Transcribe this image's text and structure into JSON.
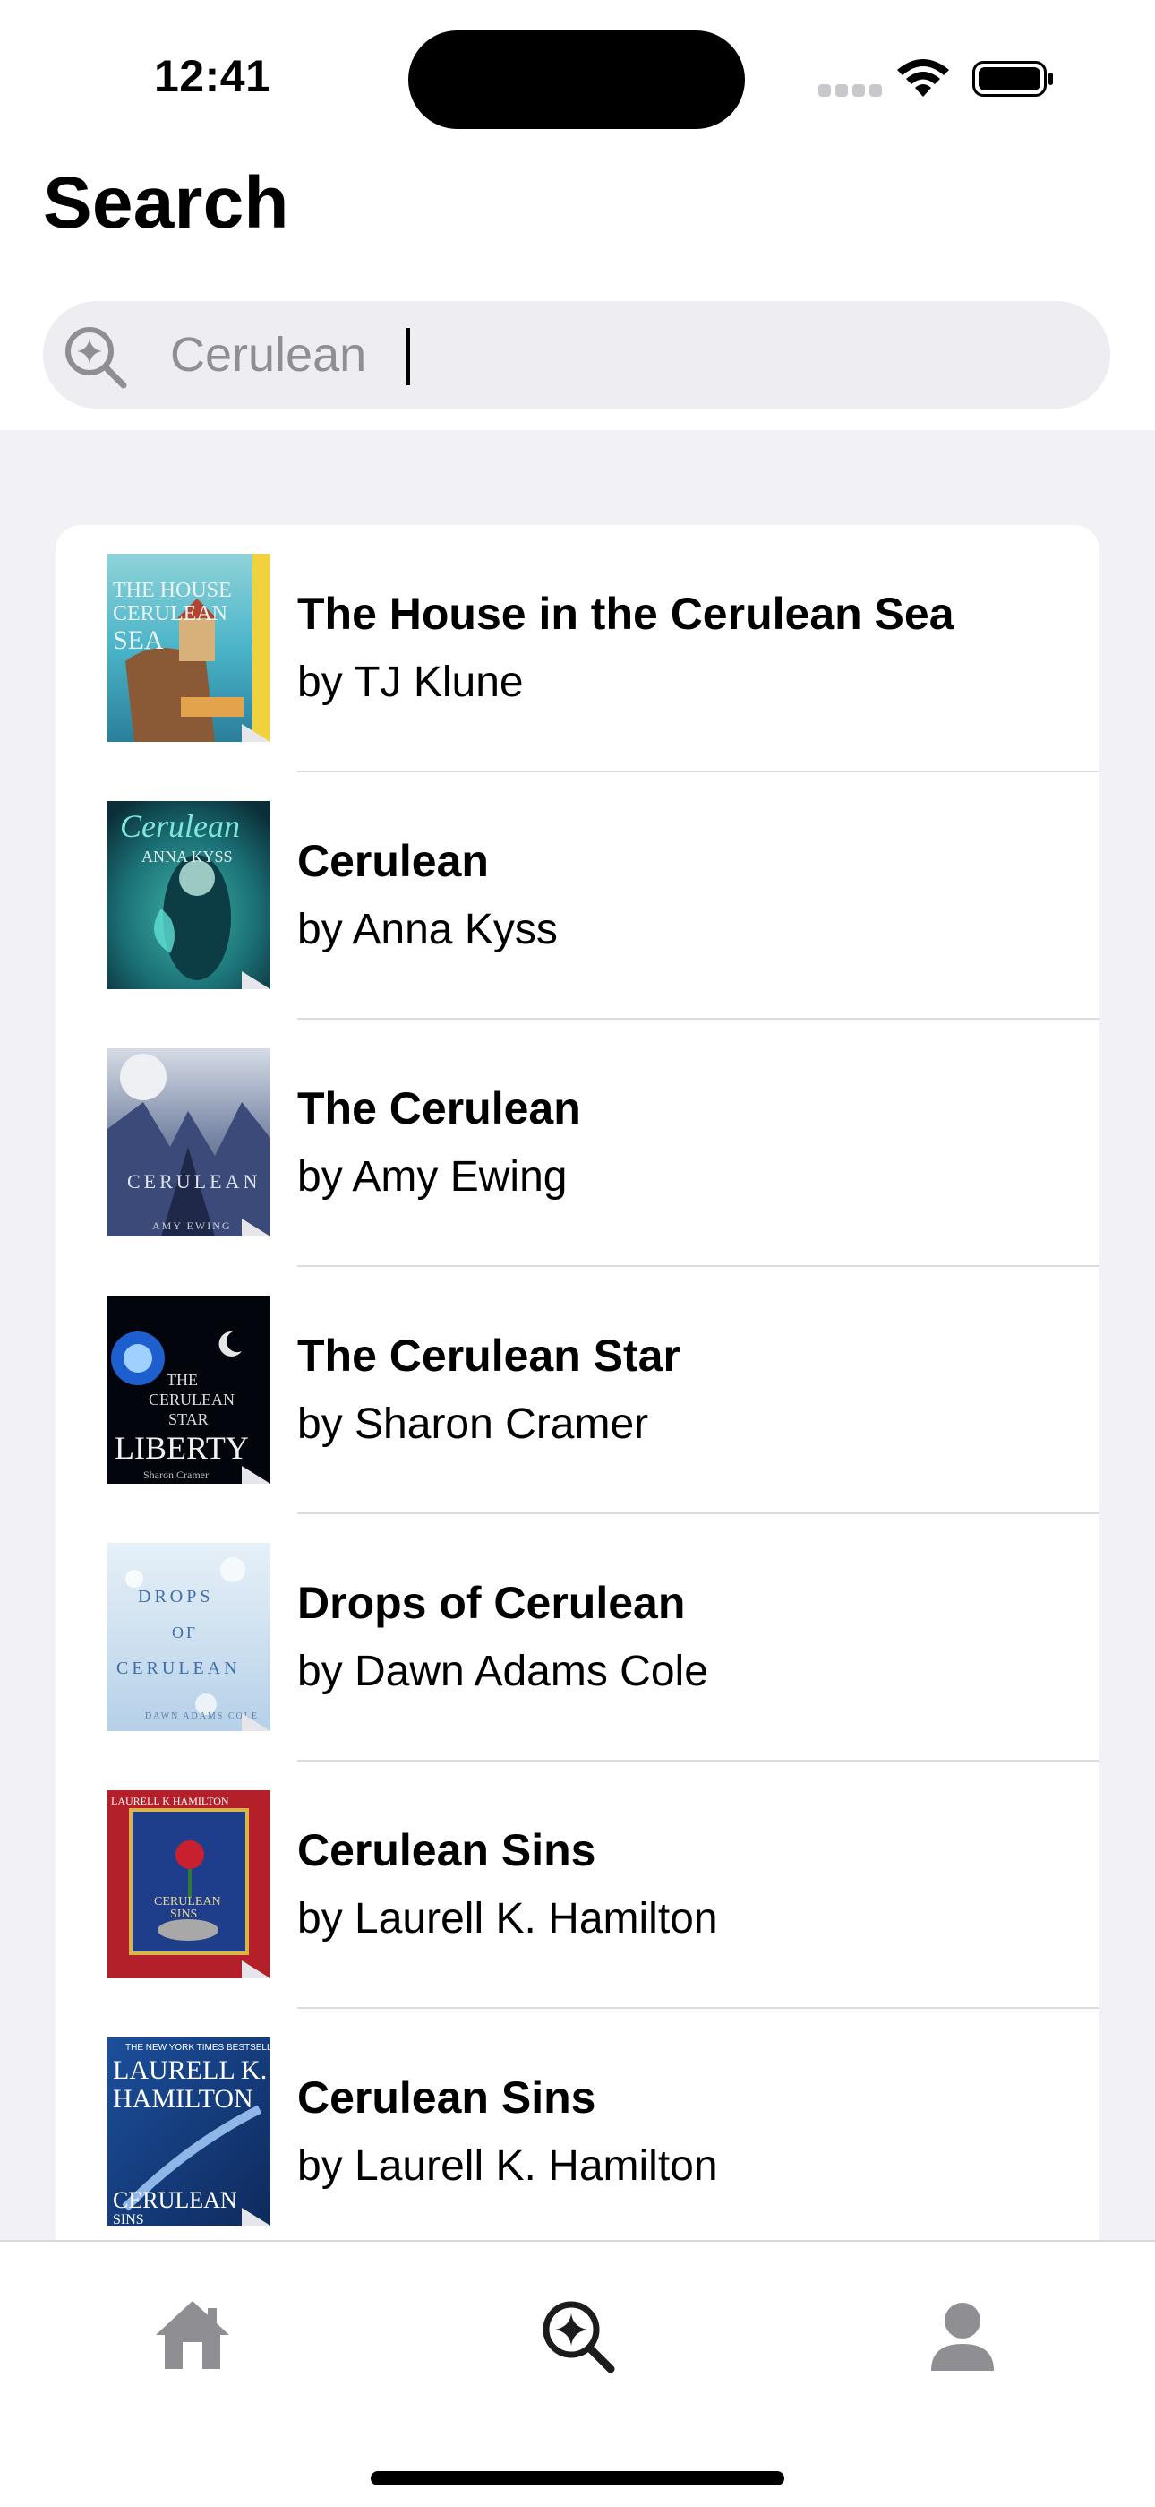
{
  "status_bar": {
    "time": "12:41"
  },
  "page": {
    "title": "Search"
  },
  "search": {
    "value": "Cerulean",
    "icon": "search-sparkle-icon"
  },
  "results": [
    {
      "title": "The House in the Cerulean Sea",
      "author": "by TJ Klune"
    },
    {
      "title": "Cerulean",
      "author": "by Anna Kyss"
    },
    {
      "title": "The Cerulean",
      "author": "by Amy Ewing"
    },
    {
      "title": "The Cerulean Star",
      "author": "by Sharon Cramer"
    },
    {
      "title": "Drops of Cerulean",
      "author": "by Dawn Adams Cole"
    },
    {
      "title": "Cerulean Sins",
      "author": "by Laurell K. Hamilton"
    },
    {
      "title": "Cerulean Sins",
      "author": "by Laurell K. Hamilton"
    }
  ],
  "tab_bar": {
    "items": [
      {
        "icon": "house-icon",
        "active": false
      },
      {
        "icon": "search-sparkle-icon",
        "active": true
      },
      {
        "icon": "person-icon",
        "active": false
      }
    ]
  },
  "colors": {
    "background": "#f1f1f6",
    "card": "#ffffff",
    "search_field": "#ededf2",
    "placeholder_text": "#8e8e93",
    "tab_active": "#1c1c1e",
    "tab_inactive": "#8e8e93"
  }
}
